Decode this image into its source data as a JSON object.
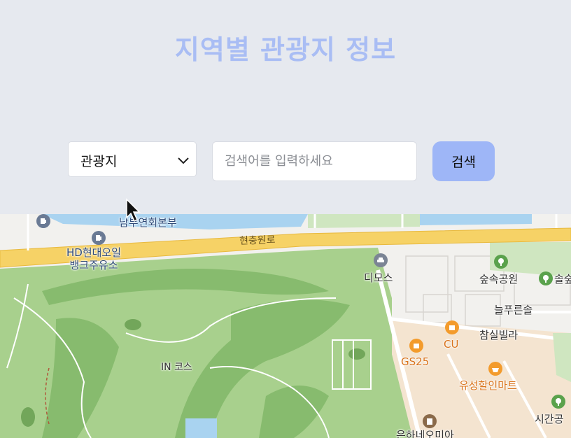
{
  "header": {
    "title": "지역별 관광지 정보"
  },
  "search": {
    "category_value": "관광지",
    "category_options": [
      "관광지"
    ],
    "placeholder": "검색어를 입력하세요",
    "button_label": "검색"
  },
  "map": {
    "labels": {
      "nambu": "남부연회본부",
      "road": "현충원로",
      "hd_oil": "HD현대오일\n뱅크주유소",
      "dimos": "디모스",
      "park1": "숲속공원",
      "park2": "솔숲",
      "neulpureun": "늘푸른솔",
      "chamsil": "참실빌라",
      "cu": "CU",
      "gs25": "GS25",
      "in_course": "IN 코스",
      "mart": "유성할인마트",
      "park3": "시간공",
      "bottom": "은하네오미아"
    },
    "colors": {
      "golf_green": "#a8d08d",
      "road_yellow": "#f6d266",
      "residential": "#f4e4d0",
      "water": "#a9d3f0",
      "poi_orange": "#f39b2c",
      "poi_green": "#5aa24c",
      "poi_gray": "#7b8494"
    }
  }
}
